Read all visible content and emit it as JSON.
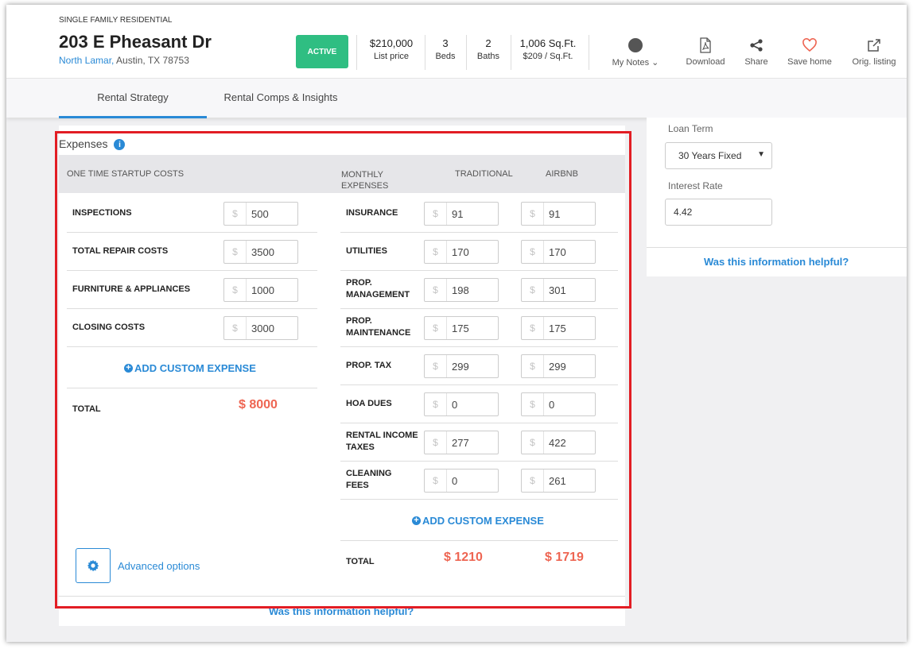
{
  "header": {
    "property_type": "SINGLE FAMILY RESIDENTIAL",
    "address": "203 E Pheasant Dr",
    "neighborhood": "North Lamar,",
    "city_state_zip": " Austin, TX 78753",
    "status": "ACTIVE",
    "price": "$210,000",
    "price_label": "List price",
    "beds": "3",
    "beds_label": "Beds",
    "baths": "2",
    "baths_label": "Baths",
    "sqft": "1,006 Sq.Ft.",
    "price_per_sqft": "$209 / Sq.Ft.",
    "actions": {
      "notes": "My Notes ⌄",
      "download": "Download",
      "share": "Share",
      "save": "Save home",
      "orig": "Orig. listing"
    }
  },
  "tabs": [
    {
      "label": "Rental Strategy",
      "active": true
    },
    {
      "label": "Rental Comps & Insights",
      "active": false
    }
  ],
  "expenses": {
    "title": "Expenses",
    "startup_header": "ONE TIME STARTUP COSTS",
    "monthly_header": "MONTHLY EXPENSES",
    "traditional_header": "TRADITIONAL",
    "airbnb_header": "AIRBNB",
    "currency": "$",
    "startup": [
      {
        "label": "INSPECTIONS",
        "value": "500"
      },
      {
        "label": "TOTAL REPAIR COSTS",
        "value": "3500"
      },
      {
        "label": "FURNITURE & APPLIANCES",
        "value": "1000"
      },
      {
        "label": "CLOSING COSTS",
        "value": "3000"
      }
    ],
    "monthly": [
      {
        "label": "INSURANCE",
        "traditional": "91",
        "airbnb": "91"
      },
      {
        "label": "UTILITIES",
        "traditional": "170",
        "airbnb": "170"
      },
      {
        "label": "PROP. MANAGEMENT",
        "traditional": "198",
        "airbnb": "301"
      },
      {
        "label": "PROP. MAINTENANCE",
        "traditional": "175",
        "airbnb": "175"
      },
      {
        "label": "PROP. TAX",
        "traditional": "299",
        "airbnb": "299"
      },
      {
        "label": "HOA DUES",
        "traditional": "0",
        "airbnb": "0"
      },
      {
        "label": "RENTAL INCOME TAXES",
        "traditional": "277",
        "airbnb": "422"
      },
      {
        "label": "CLEANING FEES",
        "traditional": "0",
        "airbnb": "261"
      }
    ],
    "add_custom": "ADD CUSTOM EXPENSE",
    "total_label": "TOTAL",
    "startup_total": "$ 8000",
    "traditional_total": "$ 1210",
    "airbnb_total": "$ 1719",
    "advanced_options": "Advanced options",
    "helpful": "Was this information helpful?"
  },
  "loan": {
    "term_label": "Loan Term",
    "term_value": "30 Years Fixed",
    "rate_label": "Interest Rate",
    "rate_value": "4.42",
    "helpful": "Was this information helpful?"
  },
  "colors": {
    "accent": "#2a8ad6",
    "active_badge": "#2fbe82",
    "total": "#ee6552",
    "highlight_box": "#e21d24"
  }
}
